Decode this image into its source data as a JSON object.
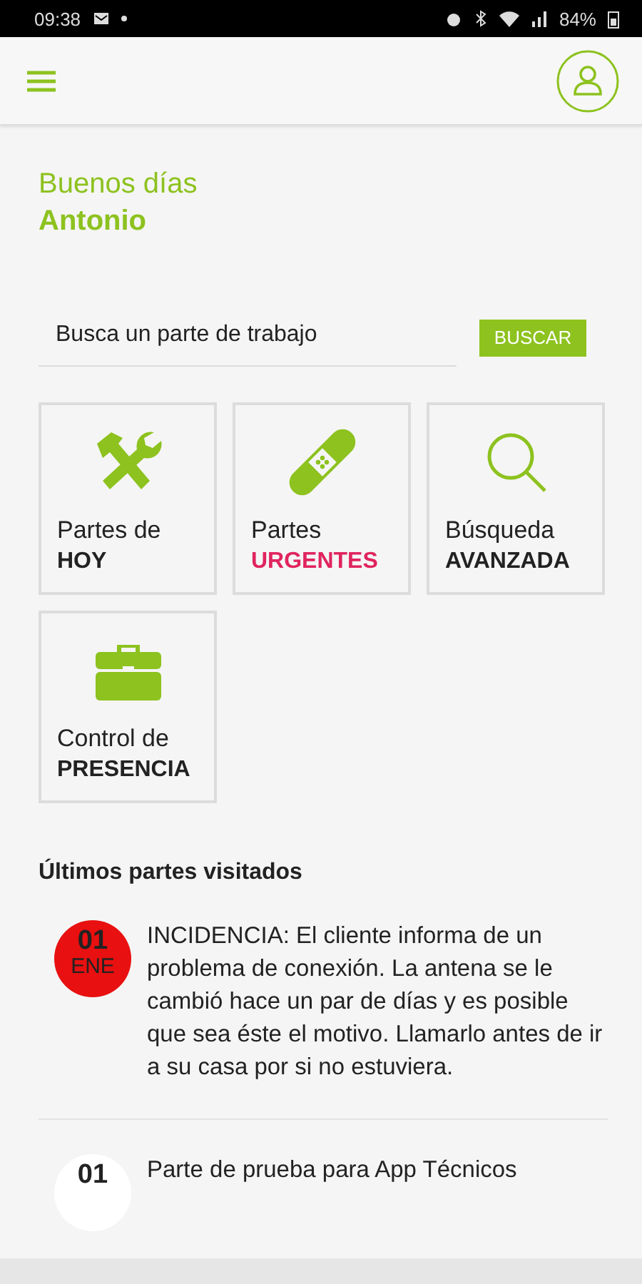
{
  "status_bar": {
    "time": "09:38",
    "battery": "84%"
  },
  "greeting": {
    "line1": "Buenos días",
    "name": "Antonio"
  },
  "search": {
    "placeholder": "Busca un parte de trabajo",
    "button": "BUSCAR"
  },
  "tiles": [
    {
      "kind": "tools",
      "line1": "Partes de",
      "line2": "HOY",
      "color": "#222222"
    },
    {
      "kind": "bandage",
      "line1": "Partes",
      "line2": "URGENTES",
      "color": "#e0245e"
    },
    {
      "kind": "search",
      "line1": "Búsqueda",
      "line2": "AVANZADA",
      "color": "#222222"
    },
    {
      "kind": "toolbox",
      "line1": "Control de",
      "line2": "PRESENCIA",
      "color": "#222222"
    }
  ],
  "recent": {
    "title": "Últimos partes visitados",
    "items": [
      {
        "day": "01",
        "month": "ENE",
        "color": "#e81010",
        "text": "INCIDENCIA: El cliente informa de un problema de conexión. La antena se le cambió hace un par de días y es posible que sea éste el motivo. Llamarlo antes de ir a su casa por si no estuviera."
      },
      {
        "day": "01",
        "color": "#ffffff",
        "text": "Parte de prueba para App Técnicos"
      }
    ]
  }
}
